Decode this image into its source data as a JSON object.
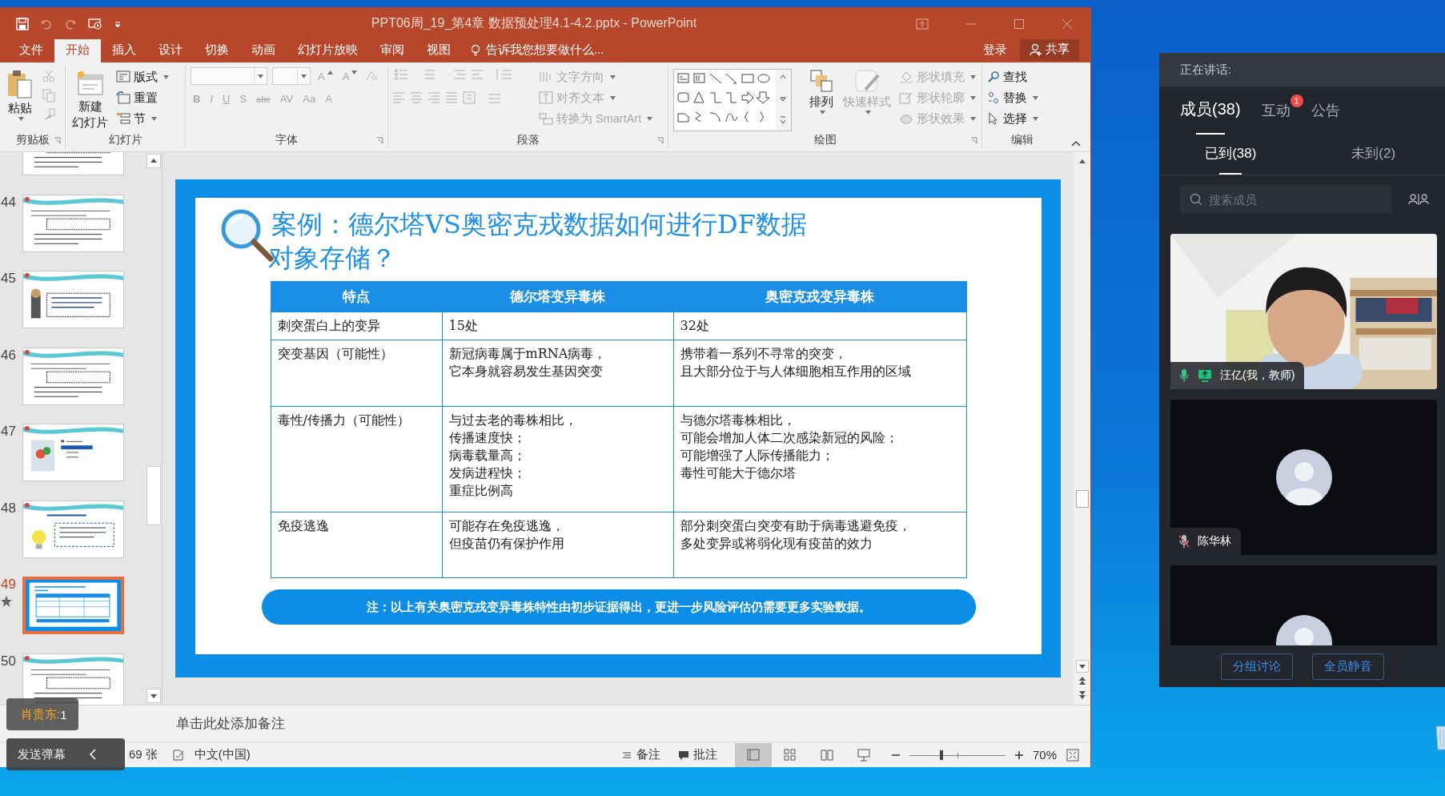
{
  "window": {
    "title": "PPT06周_19_第4章 数据预处理4.1-4.2.pptx - PowerPoint"
  },
  "menu_tabs": [
    {
      "label": "文件",
      "selected": false
    },
    {
      "label": "开始",
      "selected": true
    },
    {
      "label": "插入",
      "selected": false
    },
    {
      "label": "设计",
      "selected": false
    },
    {
      "label": "切换",
      "selected": false
    },
    {
      "label": "动画",
      "selected": false
    },
    {
      "label": "幻灯片放映",
      "selected": false
    },
    {
      "label": "审阅",
      "selected": false
    },
    {
      "label": "视图",
      "selected": false
    }
  ],
  "tell_me": "告诉我您想要做什么...",
  "account": {
    "sign_in": "登录",
    "share": "共享"
  },
  "ribbon": {
    "clipboard": {
      "title": "剪贴板",
      "paste": {
        "label": "粘贴",
        "disabled": false
      },
      "tools": [
        {
          "disabled": true
        },
        {
          "disabled": true
        },
        {
          "disabled": true
        }
      ]
    },
    "slides": {
      "title": "幻灯片",
      "new_slide": [
        "新建",
        "幻灯片"
      ],
      "commands": [
        {
          "label": "版式"
        },
        {
          "label": "重置"
        },
        {
          "label": "节"
        }
      ]
    },
    "font": {
      "title": "字体",
      "disabled": true,
      "size_buttons": [
        "A",
        "A"
      ],
      "format_buttons": [
        "B",
        "I",
        "U",
        "S",
        "abc",
        "AV",
        "Aa",
        "A"
      ]
    },
    "paragraph": {
      "title": "段落",
      "disabled": true,
      "commands": [
        {
          "label": "文字方向"
        },
        {
          "label": "对齐文本"
        },
        {
          "label": "转换为 SmartArt"
        }
      ]
    },
    "drawing": {
      "title": "绘图",
      "arrange": {
        "label": "排列",
        "disabled": false
      },
      "quick_styles": {
        "label": "快速样式",
        "disabled": true
      },
      "commands": [
        {
          "label": "形状填充",
          "disabled": true
        },
        {
          "label": "形状轮廓",
          "disabled": true
        },
        {
          "label": "形状效果",
          "disabled": true
        }
      ]
    },
    "editing": {
      "title": "编辑",
      "commands": [
        {
          "label": "查找",
          "dropdown": false
        },
        {
          "label": "替换",
          "dropdown": true
        },
        {
          "label": "选择",
          "dropdown": true
        }
      ]
    }
  },
  "thumbnails": [
    {
      "selected": false
    },
    {
      "number": "44",
      "selected": false,
      "star": false
    },
    {
      "number": "45",
      "selected": false,
      "star": false
    },
    {
      "number": "46",
      "selected": false,
      "star": false
    },
    {
      "number": "47",
      "selected": false,
      "star": false
    },
    {
      "number": "48",
      "selected": false,
      "star": false
    },
    {
      "number": "49",
      "selected": true,
      "star": true
    },
    {
      "number": "50",
      "selected": false,
      "star": false
    }
  ],
  "slide": {
    "title_lines": [
      "案例：德尔塔VS奥密克戎数据如何进行DF数据",
      "对象存储？"
    ],
    "table": {
      "columns": [
        "特点",
        "德尔塔变异毒株",
        "奥密克戎变异毒株"
      ],
      "rows": [
        [
          [
            "刺突蛋白上的变异"
          ],
          [
            "15处"
          ],
          [
            "32处"
          ]
        ],
        [
          [
            "突变基因（可能性）"
          ],
          [
            "新冠病毒属于mRNA病毒，",
            "它本身就容易发生基因突变"
          ],
          [
            "携带着一系列不寻常的突变，",
            "且大部分位于与人体细胞相互作用的区域"
          ]
        ],
        [
          [
            "毒性/传播力（可能性）"
          ],
          [
            "与过去老的毒株相比，",
            "传播速度快；",
            "病毒载量高；",
            "发病进程快；",
            "重症比例高"
          ],
          [
            "与德尔塔毒株相比，",
            "可能会增加人体二次感染新冠的风险；",
            "可能增强了人际传播能力；",
            "毒性可能大于德尔塔"
          ]
        ],
        [
          [
            "免疫逃逸"
          ],
          [
            "可能存在免疫逃逸，",
            "但疫苗仍有保护作用"
          ],
          [
            "部分刺突蛋白突变有助于病毒逃避免疫，",
            "多处变异或将弱化现有疫苗的效力"
          ]
        ]
      ]
    },
    "note": "注：以上有关奥密克戎变异毒株特性由初步证据得出，更进一步风险评估仍需要更多实验数据。"
  },
  "notes_placeholder": "单击此处添加备注",
  "status_bar": {
    "slide_count": "69 张",
    "language": "中文(中国)",
    "notes": "备注",
    "comments": "批注",
    "views": [
      {
        "selected": true
      },
      {
        "selected": false
      },
      {
        "selected": false
      },
      {
        "selected": false
      }
    ],
    "zoom": {
      "level": 0.33,
      "reading": "70%"
    }
  },
  "overlays": {
    "danmaku_user": {
      "name": "肖贵东:",
      "count": "1"
    },
    "send_danmaku": "发送弹幕"
  },
  "meeting": {
    "speaking": "正在讲话:",
    "tabs": [
      {
        "label": "成员(38)",
        "selected": true
      },
      {
        "label": "互动",
        "selected": false,
        "badge": "1"
      },
      {
        "label": "公告",
        "selected": false
      }
    ],
    "subtabs": [
      {
        "label": "已到(38)",
        "selected": true
      },
      {
        "label": "未到(2)",
        "selected": false
      }
    ],
    "search": {
      "placeholder": "搜索成员"
    },
    "participants": [
      {
        "kind": "video",
        "name": "汪亿(我，教师)",
        "mic_muted": false,
        "sharing": true
      },
      {
        "kind": "avatar",
        "name": "陈华林",
        "mic_muted": true,
        "sharing": false
      },
      {
        "kind": "avatar"
      }
    ],
    "buttons": [
      "分组讨论",
      "全员静音"
    ]
  }
}
